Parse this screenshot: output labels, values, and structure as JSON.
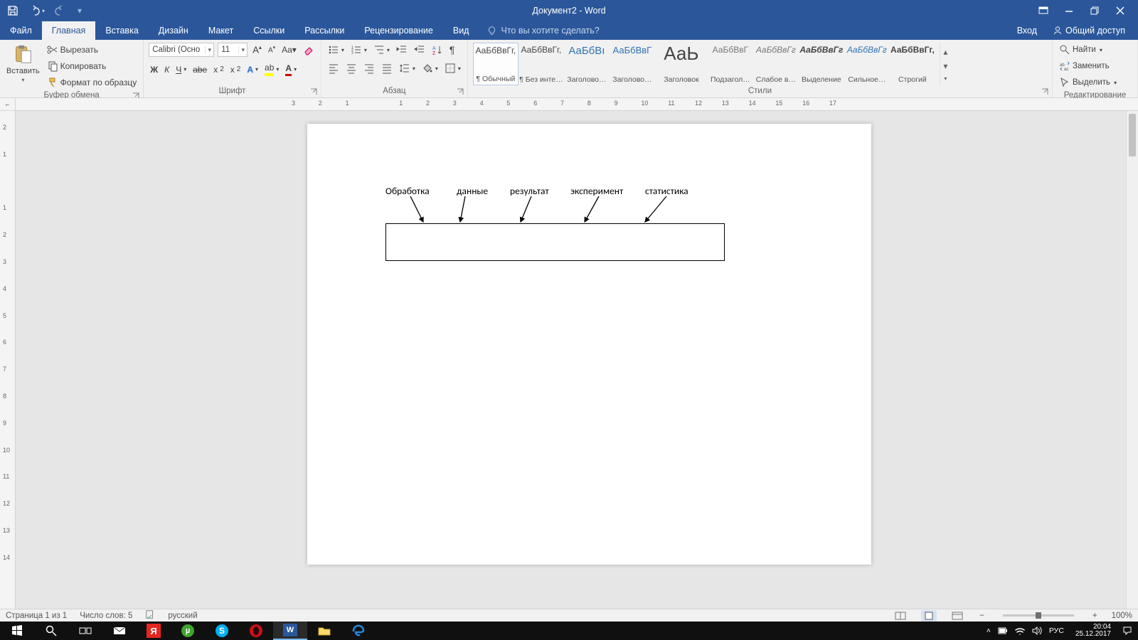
{
  "title": "Документ2 - Word",
  "tabs": {
    "file": "Файл",
    "items": [
      "Главная",
      "Вставка",
      "Дизайн",
      "Макет",
      "Ссылки",
      "Рассылки",
      "Рецензирование",
      "Вид"
    ],
    "active": 0,
    "tell_me": "Что вы хотите сделать?",
    "sign_in": "Вход",
    "share": "Общий доступ"
  },
  "clipboard": {
    "paste": "Вставить",
    "cut": "Вырезать",
    "copy": "Копировать",
    "format_painter": "Формат по образцу",
    "group": "Буфер обмена"
  },
  "font": {
    "name": "Calibri (Осно",
    "size": "11",
    "group": "Шрифт",
    "bold": "Ж",
    "italic": "К",
    "underline": "Ч"
  },
  "paragraph": {
    "group": "Абзац"
  },
  "styles": {
    "group": "Стили",
    "items": [
      {
        "prev": "АаБбВвГг,",
        "name": "¶ Обычный",
        "sel": true,
        "cls": ""
      },
      {
        "prev": "АаБбВвГг,",
        "name": "¶ Без инте…",
        "cls": ""
      },
      {
        "prev": "АаБбВı",
        "name": "Заголово…",
        "cls": "c1"
      },
      {
        "prev": "АаБбВвГ",
        "name": "Заголово…",
        "cls": "c2"
      },
      {
        "prev": "АаЬ",
        "name": "Заголовок",
        "cls": "big"
      },
      {
        "prev": "АаБбВвГ",
        "name": "Подзагол…",
        "cls": "c3"
      },
      {
        "prev": "АаБбВвГг",
        "name": "Слабое в…",
        "cls": "c4"
      },
      {
        "prev": "АаБбВвГг",
        "name": "Выделение",
        "cls": "c5"
      },
      {
        "prev": "АаБбВвГг",
        "name": "Сильное…",
        "cls": "c6"
      },
      {
        "prev": "АаБбВвГг,",
        "name": "Строгий",
        "cls": "c7"
      }
    ]
  },
  "editing": {
    "group": "Редактирование",
    "find": "Найти",
    "replace": "Заменить",
    "select": "Выделить"
  },
  "document": {
    "labels": [
      "Обработка",
      "данные",
      "результат",
      "эксперимент",
      "статистика"
    ]
  },
  "status": {
    "page": "Страница 1 из 1",
    "words": "Число слов: 5",
    "lang": "русский",
    "zoom": "100%"
  },
  "ruler_h": [
    "3",
    "2",
    "1",
    "",
    "1",
    "2",
    "3",
    "4",
    "5",
    "6",
    "7",
    "8",
    "9",
    "10",
    "11",
    "12",
    "13",
    "14",
    "15",
    "16",
    "17"
  ],
  "ruler_v": [
    "2",
    "1",
    "",
    "1",
    "2",
    "3",
    "4",
    "5",
    "6",
    "7",
    "8",
    "9",
    "10",
    "11",
    "12",
    "13",
    "14"
  ],
  "taskbar": {
    "time": "20:04",
    "date": "25.12.2017",
    "lang": "РУС"
  }
}
